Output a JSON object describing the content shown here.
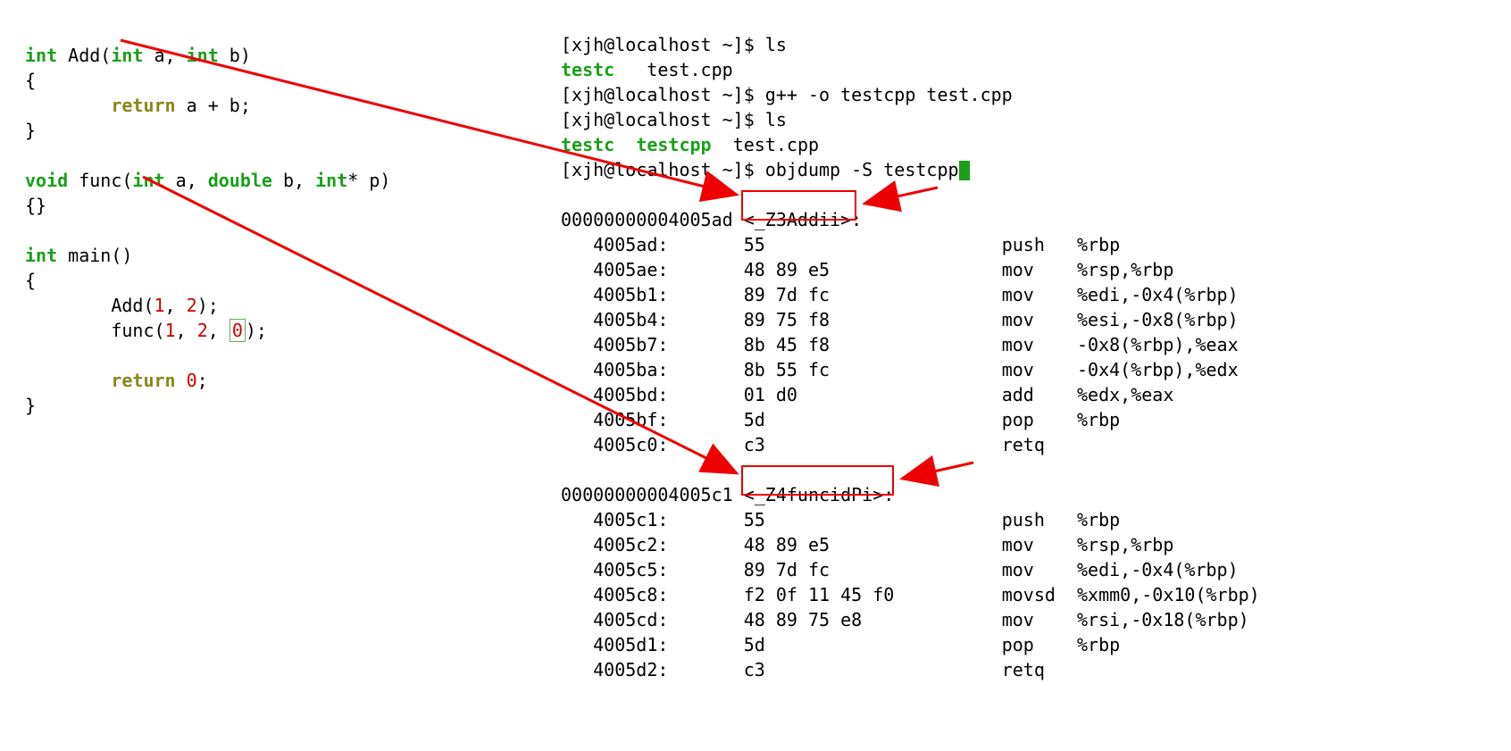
{
  "code": {
    "kw_int1": "int",
    "fn_add": " Add(",
    "kw_int2": "int",
    "param_a": " a, ",
    "kw_int3": "int",
    "param_b": " b)",
    "lbrace1": "{",
    "indent": "        ",
    "kw_return1": "return",
    "ret_expr": " a + b;",
    "rbrace1": "}",
    "kw_void": "void",
    "fn_func": " func(",
    "kw_int4": "int",
    "param_a2": " a, ",
    "kw_double": "double",
    "param_b2": " b, ",
    "kw_intp": "int",
    "param_p": "* p)",
    "empty_braces": "{}",
    "kw_int5": "int",
    "fn_main": " main()",
    "lbrace2": "{",
    "call_add_pre": "        Add(",
    "lit1": "1",
    "comma1": ", ",
    "lit2": "2",
    "call_add_post": ");",
    "call_func_pre": "        func(",
    "litf1": "1",
    "commaf1": ", ",
    "litf2": "2",
    "commaf2": ", ",
    "litf0": "0",
    "call_func_post": ");",
    "kw_return2": "return",
    "ret0_pre": " ",
    "ret0": "0",
    "ret0_post": ";",
    "rbrace2": "}"
  },
  "terminal": {
    "prompt1": "[xjh@localhost ~]$ ",
    "cmd1": "ls",
    "out1a": "testc",
    "out1b": "   test.cpp",
    "prompt2": "[xjh@localhost ~]$ ",
    "cmd2": "g++ -o testcpp test.cpp",
    "prompt3": "[xjh@localhost ~]$ ",
    "cmd3": "ls",
    "out3a": "testc",
    "out3b": "  ",
    "out3c": "testcpp",
    "out3d": "  test.cpp",
    "prompt4": "[xjh@localhost ~]$ ",
    "cmd4": "objdump -S testcpp"
  },
  "disasm": {
    "sym1_addr": "00000000004005ad ",
    "sym1_name": "<_Z3Addii>",
    "colon": ":",
    "r1": {
      "a": "   4005ad:",
      "b": "       55                      ",
      "m": "push   ",
      "o": "%rbp"
    },
    "r2": {
      "a": "   4005ae:",
      "b": "       48 89 e5                ",
      "m": "mov    ",
      "o": "%rsp,%rbp"
    },
    "r3": {
      "a": "   4005b1:",
      "b": "       89 7d fc                ",
      "m": "mov    ",
      "o": "%edi,-0x4(%rbp)"
    },
    "r4": {
      "a": "   4005b4:",
      "b": "       89 75 f8                ",
      "m": "mov    ",
      "o": "%esi,-0x8(%rbp)"
    },
    "r5": {
      "a": "   4005b7:",
      "b": "       8b 45 f8                ",
      "m": "mov    ",
      "o": "-0x8(%rbp),%eax"
    },
    "r6": {
      "a": "   4005ba:",
      "b": "       8b 55 fc                ",
      "m": "mov    ",
      "o": "-0x4(%rbp),%edx"
    },
    "r7": {
      "a": "   4005bd:",
      "b": "       01 d0                   ",
      "m": "add    ",
      "o": "%edx,%eax"
    },
    "r8": {
      "a": "   4005bf:",
      "b": "       5d                      ",
      "m": "pop    ",
      "o": "%rbp"
    },
    "r9": {
      "a": "   4005c0:",
      "b": "       c3                      ",
      "m": "retq   ",
      "o": ""
    },
    "sym2_addr": "00000000004005c1 ",
    "sym2_name": "<_Z4funcidPi>",
    "s1": {
      "a": "   4005c1:",
      "b": "       55                      ",
      "m": "push   ",
      "o": "%rbp"
    },
    "s2": {
      "a": "   4005c2:",
      "b": "       48 89 e5                ",
      "m": "mov    ",
      "o": "%rsp,%rbp"
    },
    "s3": {
      "a": "   4005c5:",
      "b": "       89 7d fc                ",
      "m": "mov    ",
      "o": "%edi,-0x4(%rbp)"
    },
    "s4": {
      "a": "   4005c8:",
      "b": "       f2 0f 11 45 f0          ",
      "m": "movsd  ",
      "o": "%xmm0,-0x10(%rbp)"
    },
    "s5": {
      "a": "   4005cd:",
      "b": "       48 89 75 e8             ",
      "m": "mov    ",
      "o": "%rsi,-0x18(%rbp)"
    },
    "s6": {
      "a": "   4005d1:",
      "b": "       5d                      ",
      "m": "pop    ",
      "o": "%rbp"
    },
    "s7": {
      "a": "   4005d2:",
      "b": "       c3                      ",
      "m": "retq   ",
      "o": ""
    }
  }
}
